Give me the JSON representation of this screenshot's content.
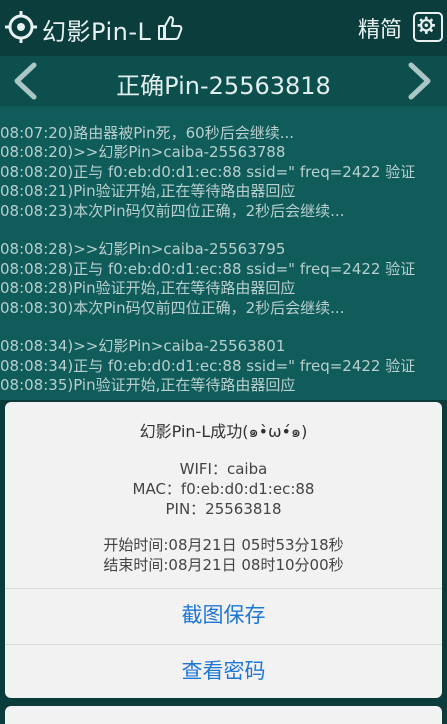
{
  "appbar": {
    "title": "幻影Pin-L",
    "lang_toggle": "精简"
  },
  "navbar": {
    "pin_title": "正确Pin-25563818"
  },
  "log": {
    "lines": [
      "08:07:20)路由器被Pin死，60秒后会继续...",
      "08:08:20)>>幻影Pin>caiba-25563788",
      "08:08:20)正与 f0:eb:d0:d1:ec:88 ssid=\" freq=2422 验证",
      "08:08:21)Pin验证开始,正在等待路由器回应",
      "08:08:23)本次Pin码仅前四位正确，2秒后会继续...",
      "",
      "08:08:28)>>幻影Pin>caiba-25563795",
      "08:08:28)正与 f0:eb:d0:d1:ec:88 ssid=\" freq=2422 验证",
      "08:08:28)Pin验证开始,正在等待路由器回应",
      "08:08:30)本次Pin码仅前四位正确，2秒后会继续...",
      "",
      "08:08:34)>>幻影Pin>caiba-25563801",
      "08:08:34)正与 f0:eb:d0:d1:ec:88 ssid=\" freq=2422 验证",
      "08:08:35)Pin验证开始,正在等待路由器回应"
    ]
  },
  "dialog": {
    "title": "幻影Pin-L成功(๑•̀ω•́๑)",
    "wifi": "WIFI：caiba",
    "mac": "MAC：f0:eb:d0:d1:ec:88",
    "pin": "PIN：25563818",
    "start_time": "开始时间:08月21日 05时53分18秒",
    "end_time": "结束时间:08月21日 08时10分00秒",
    "btn_screenshot": "截图保存",
    "btn_view_password": "查看密码"
  }
}
